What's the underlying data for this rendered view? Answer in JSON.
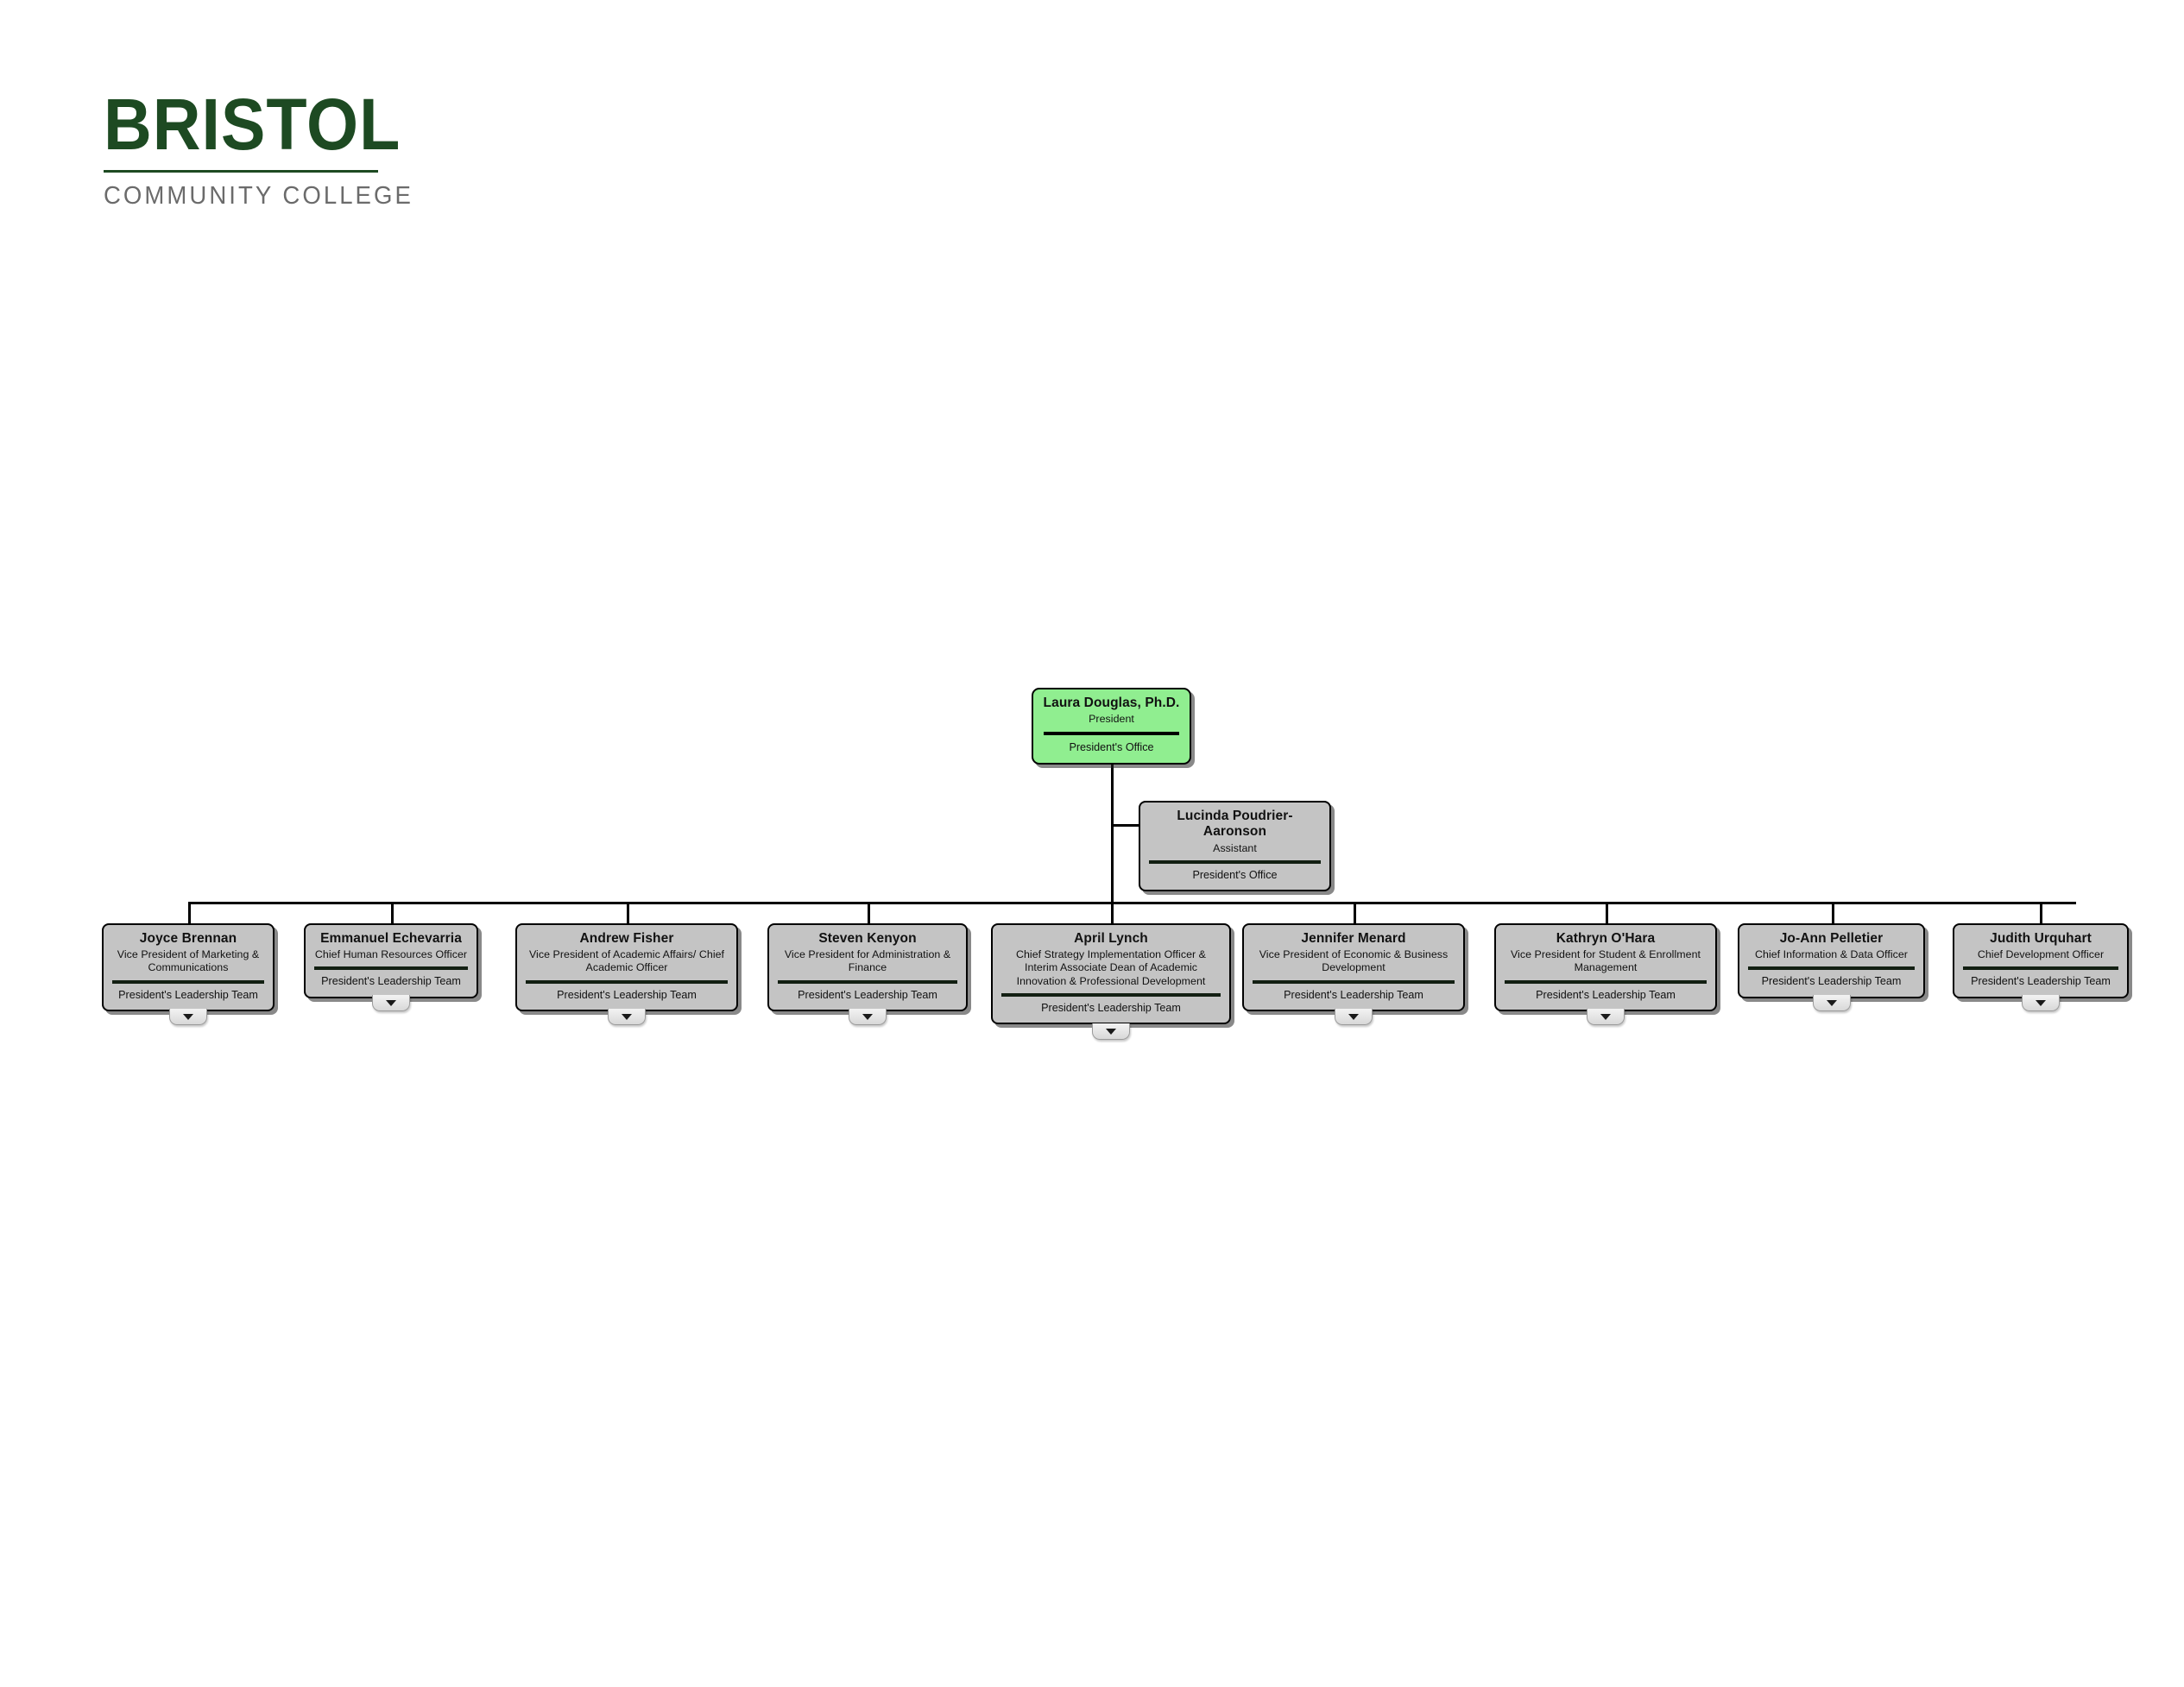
{
  "logo": {
    "wordmark": "BRISTOL",
    "subwordmark": "COMMUNITY COLLEGE",
    "brand_green": "#1d4a22",
    "brand_gray": "#6b6b6b"
  },
  "chart": {
    "type": "org-chart",
    "president_node_color": "#90ee90",
    "node_color": "#c4c4c4",
    "president": {
      "name": "Laura Douglas, Ph.D.",
      "title": "President",
      "department": "President's Office"
    },
    "assistant": {
      "name": "Lucinda Poudrier-Aaronson",
      "title": "Assistant",
      "department": "President's Office"
    },
    "direct_reports": [
      {
        "name": "Joyce Brennan",
        "title": "Vice President of Marketing & Communications",
        "department": "President's Leadership Team",
        "expander": "chevron-down-icon"
      },
      {
        "name": "Emmanuel Echevarria",
        "title": "Chief Human Resources Officer",
        "department": "President's Leadership Team",
        "expander": "chevron-down-icon"
      },
      {
        "name": "Andrew Fisher",
        "title": "Vice President of Academic Affairs/ Chief Academic Officer",
        "department": "President's Leadership Team",
        "expander": "chevron-down-icon"
      },
      {
        "name": "Steven Kenyon",
        "title": "Vice President for Administration & Finance",
        "department": "President's Leadership Team",
        "expander": "chevron-down-icon"
      },
      {
        "name": "April Lynch",
        "title": "Chief Strategy Implementation Officer & Interim Associate Dean of Academic Innovation & Professional Development",
        "department": "President's Leadership Team",
        "expander": "chevron-down-icon"
      },
      {
        "name": "Jennifer Menard",
        "title": "Vice President of Economic & Business Development",
        "department": "President's Leadership Team",
        "expander": "chevron-down-icon"
      },
      {
        "name": "Kathryn O'Hara",
        "title": "Vice President for Student & Enrollment Management",
        "department": "President's Leadership Team",
        "expander": "chevron-down-icon"
      },
      {
        "name": "Jo-Ann Pelletier",
        "title": "Chief Information & Data Officer",
        "department": "President's Leadership Team",
        "expander": "chevron-down-icon"
      },
      {
        "name": "Judith Urquhart",
        "title": "Chief Development Officer",
        "department": "President's Leadership Team",
        "expander": "chevron-down-icon"
      }
    ]
  }
}
